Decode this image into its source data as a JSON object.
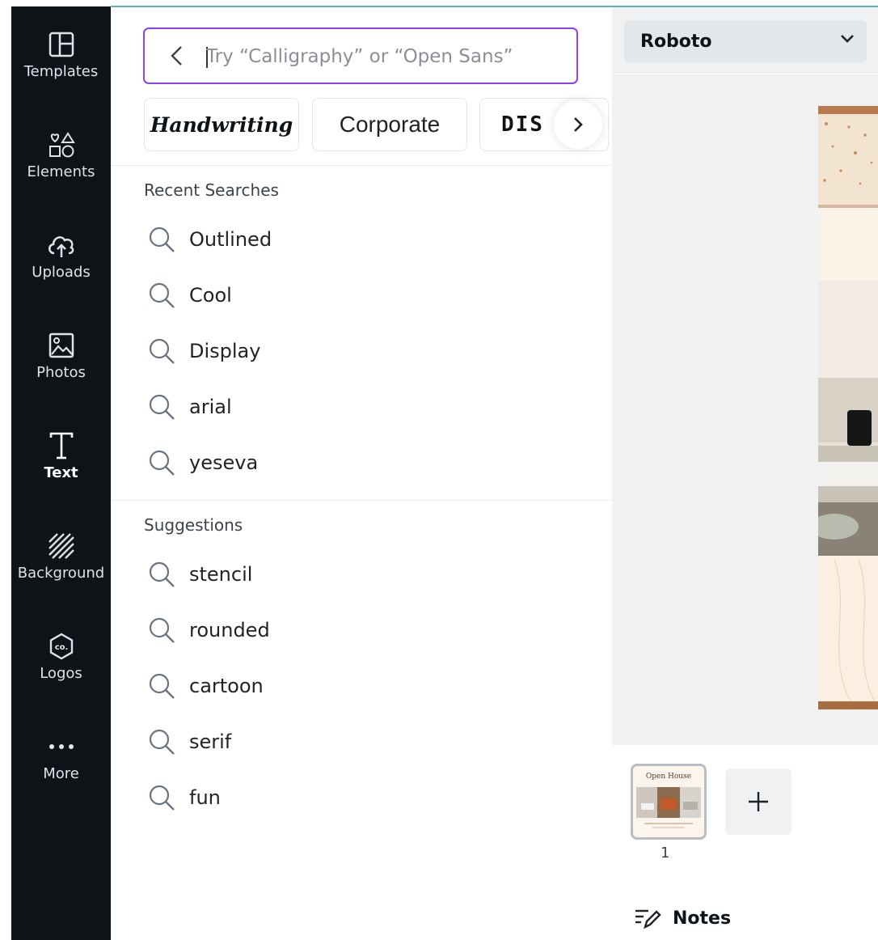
{
  "nav": {
    "items": [
      {
        "label": "Templates",
        "icon": "templates-icon"
      },
      {
        "label": "Elements",
        "icon": "elements-icon"
      },
      {
        "label": "Uploads",
        "icon": "uploads-icon"
      },
      {
        "label": "Photos",
        "icon": "photos-icon"
      },
      {
        "label": "Text",
        "icon": "text-icon",
        "active": true
      },
      {
        "label": "Background",
        "icon": "background-icon"
      },
      {
        "label": "Logos",
        "icon": "logos-icon"
      },
      {
        "label": "More",
        "icon": "more-icon"
      }
    ]
  },
  "search": {
    "placeholder": "Try “Calligraphy” or “Open Sans”",
    "value": ""
  },
  "chips": {
    "handwriting": "Handwriting",
    "corporate": "Corporate",
    "display": "DIS"
  },
  "recent": {
    "title": "Recent Searches",
    "items": [
      "Outlined",
      "Cool",
      "Display",
      "arial",
      "yeseva"
    ]
  },
  "suggestions": {
    "title": "Suggestions",
    "items": [
      "stencil",
      "rounded",
      "cartoon",
      "serif",
      "fun"
    ]
  },
  "font_select": {
    "value": "Roboto"
  },
  "pages": {
    "thumb_title": "Open House",
    "page_number": "1"
  },
  "notes": {
    "label": "Notes"
  },
  "colors": {
    "nav_bg": "#0e1318",
    "accent": "#8b3dff",
    "top_line": "#58b5c0"
  }
}
